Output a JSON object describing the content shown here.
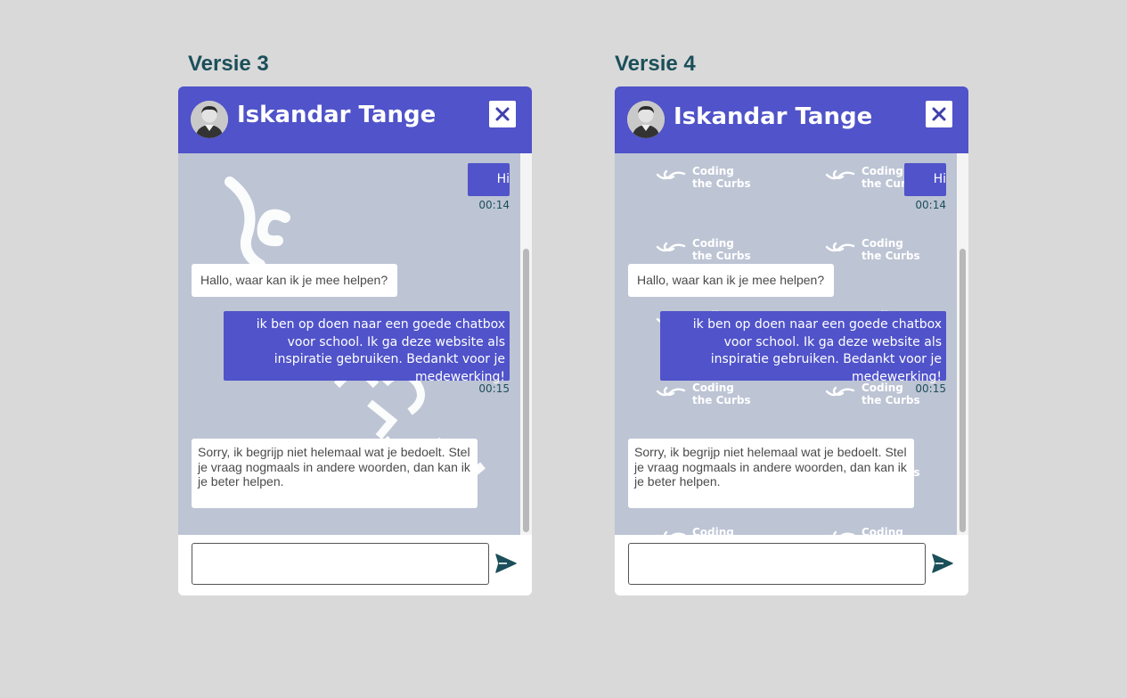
{
  "versions": [
    {
      "title": "Versie 3",
      "background": "diagonal-logo-watermark",
      "header": {
        "contact_name": "Iskandar Tange",
        "close_icon": "close-icon"
      },
      "messages": {
        "user_hi": "Hi",
        "time_1": "00:14",
        "bot_greeting": "Hallo, waar kan ik je mee helpen?",
        "user_long": "ik ben op doen naar een goede chatbox voor school. Ik ga deze website als inspiratie gebruiken. Bedankt voor je medewerking!",
        "time_2": "00:15",
        "bot_sorry": "Sorry, ik begrijp niet helemaal wat je bedoelt. Stel je vraag nogmaals in andere woorden, dan kan ik je beter helpen."
      },
      "composer": {
        "input_value": "",
        "send_icon": "send-icon"
      }
    },
    {
      "title": "Versie 4",
      "background": "tiled-logo-pattern",
      "logo_text": {
        "line1": "Coding",
        "line2": "the Curbs"
      },
      "header": {
        "contact_name": "Iskandar Tange",
        "close_icon": "close-icon"
      },
      "messages": {
        "user_hi": "Hi",
        "time_1": "00:14",
        "bot_greeting": "Hallo, waar kan ik je mee helpen?",
        "user_long": "ik ben op doen naar een goede chatbox voor school. Ik ga deze website als inspiratie gebruiken. Bedankt voor je medewerking!",
        "time_2": "00:15",
        "bot_sorry": "Sorry, ik begrijp niet helemaal wat je bedoelt. Stel je vraag nogmaals in andere woorden, dan kan ik je beter helpen."
      },
      "composer": {
        "input_value": "",
        "send_icon": "send-icon"
      }
    }
  ],
  "colors": {
    "page_background": "#d9d9d9",
    "header": "#5053c9",
    "user_bubble": "#5053c9",
    "chat_background": "#bdc4d4",
    "title_text": "#1b4f5a",
    "send_icon": "#1b4f5a"
  }
}
